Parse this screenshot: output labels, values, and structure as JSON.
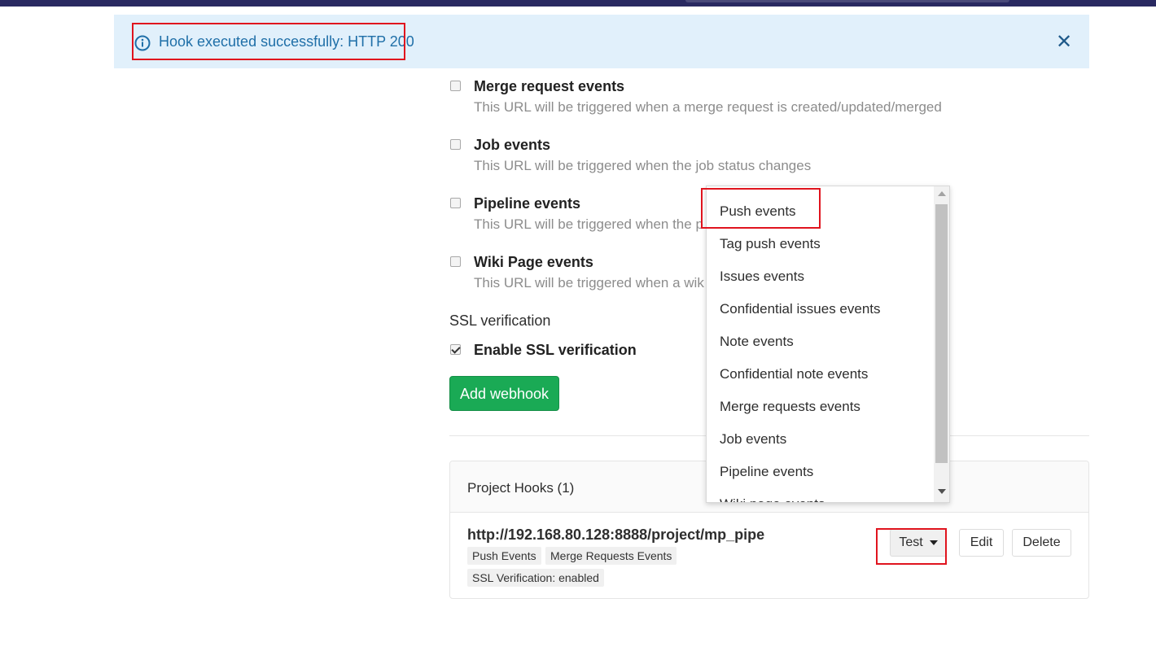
{
  "flash": {
    "message": "Hook executed successfully: HTTP 200",
    "icon": "info-icon",
    "close_icon": "close-icon",
    "color": "#1f6fa8",
    "background": "#e1f0fb"
  },
  "events": [
    {
      "title": "Merge request events",
      "description": "This URL will be triggered when a merge request is created/updated/merged",
      "checked": false
    },
    {
      "title": "Job events",
      "description": "This URL will be triggered when the job status changes",
      "checked": false
    },
    {
      "title": "Pipeline events",
      "description": "This URL will be triggered when the p",
      "checked": false
    },
    {
      "title": "Wiki Page events",
      "description": "This URL will be triggered when a wik",
      "checked": false
    }
  ],
  "ssl": {
    "heading": "SSL verification",
    "checkbox_label": "Enable SSL verification",
    "checked": true
  },
  "add_button": "Add webhook",
  "hooks": {
    "title": "Project Hooks (1)",
    "items": [
      {
        "url": "http://192.168.80.128:8888/project/mp_pipe",
        "tags": [
          "Push Events",
          "Merge Requests Events"
        ],
        "ssl_tag": "SSL Verification: enabled",
        "test_label": "Test",
        "edit_label": "Edit",
        "delete_label": "Delete"
      }
    ]
  },
  "dropdown": {
    "items": [
      "Push events",
      "Tag push events",
      "Issues events",
      "Confidential issues events",
      "Note events",
      "Confidential note events",
      "Merge requests events",
      "Job events",
      "Pipeline events",
      "Wiki page events"
    ]
  },
  "colors": {
    "accent_green": "#1aaa55",
    "highlight_red": "#e0141e",
    "topbar": "#292961"
  }
}
